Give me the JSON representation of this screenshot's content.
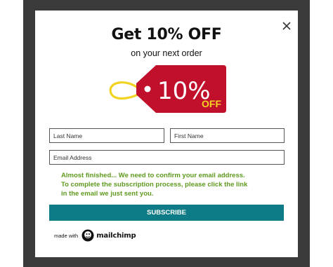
{
  "popup": {
    "title": "Get 10% OFF",
    "subtitle": "on your next order",
    "tag_percent": "10%",
    "tag_off": "OFF",
    "tag_color": "#c0102c",
    "string_color": "#f3d322"
  },
  "form": {
    "last_name_placeholder": "Last Name",
    "first_name_placeholder": "First Name",
    "email_placeholder": "Email Address",
    "confirm_message_lines": [
      "Almost finished... We need to confirm your email address.",
      "To complete the subscription process, please click the link",
      "in the email we just sent you."
    ],
    "message_color": "#5f9a1f",
    "subscribe_label": "SUBSCRIBE",
    "button_color": "#0e7c86"
  },
  "footer": {
    "made_with": "made with",
    "brand": "mailchimp",
    "brand_icon": "mailchimp-freddie-icon"
  },
  "icons": {
    "close": "close-icon"
  }
}
